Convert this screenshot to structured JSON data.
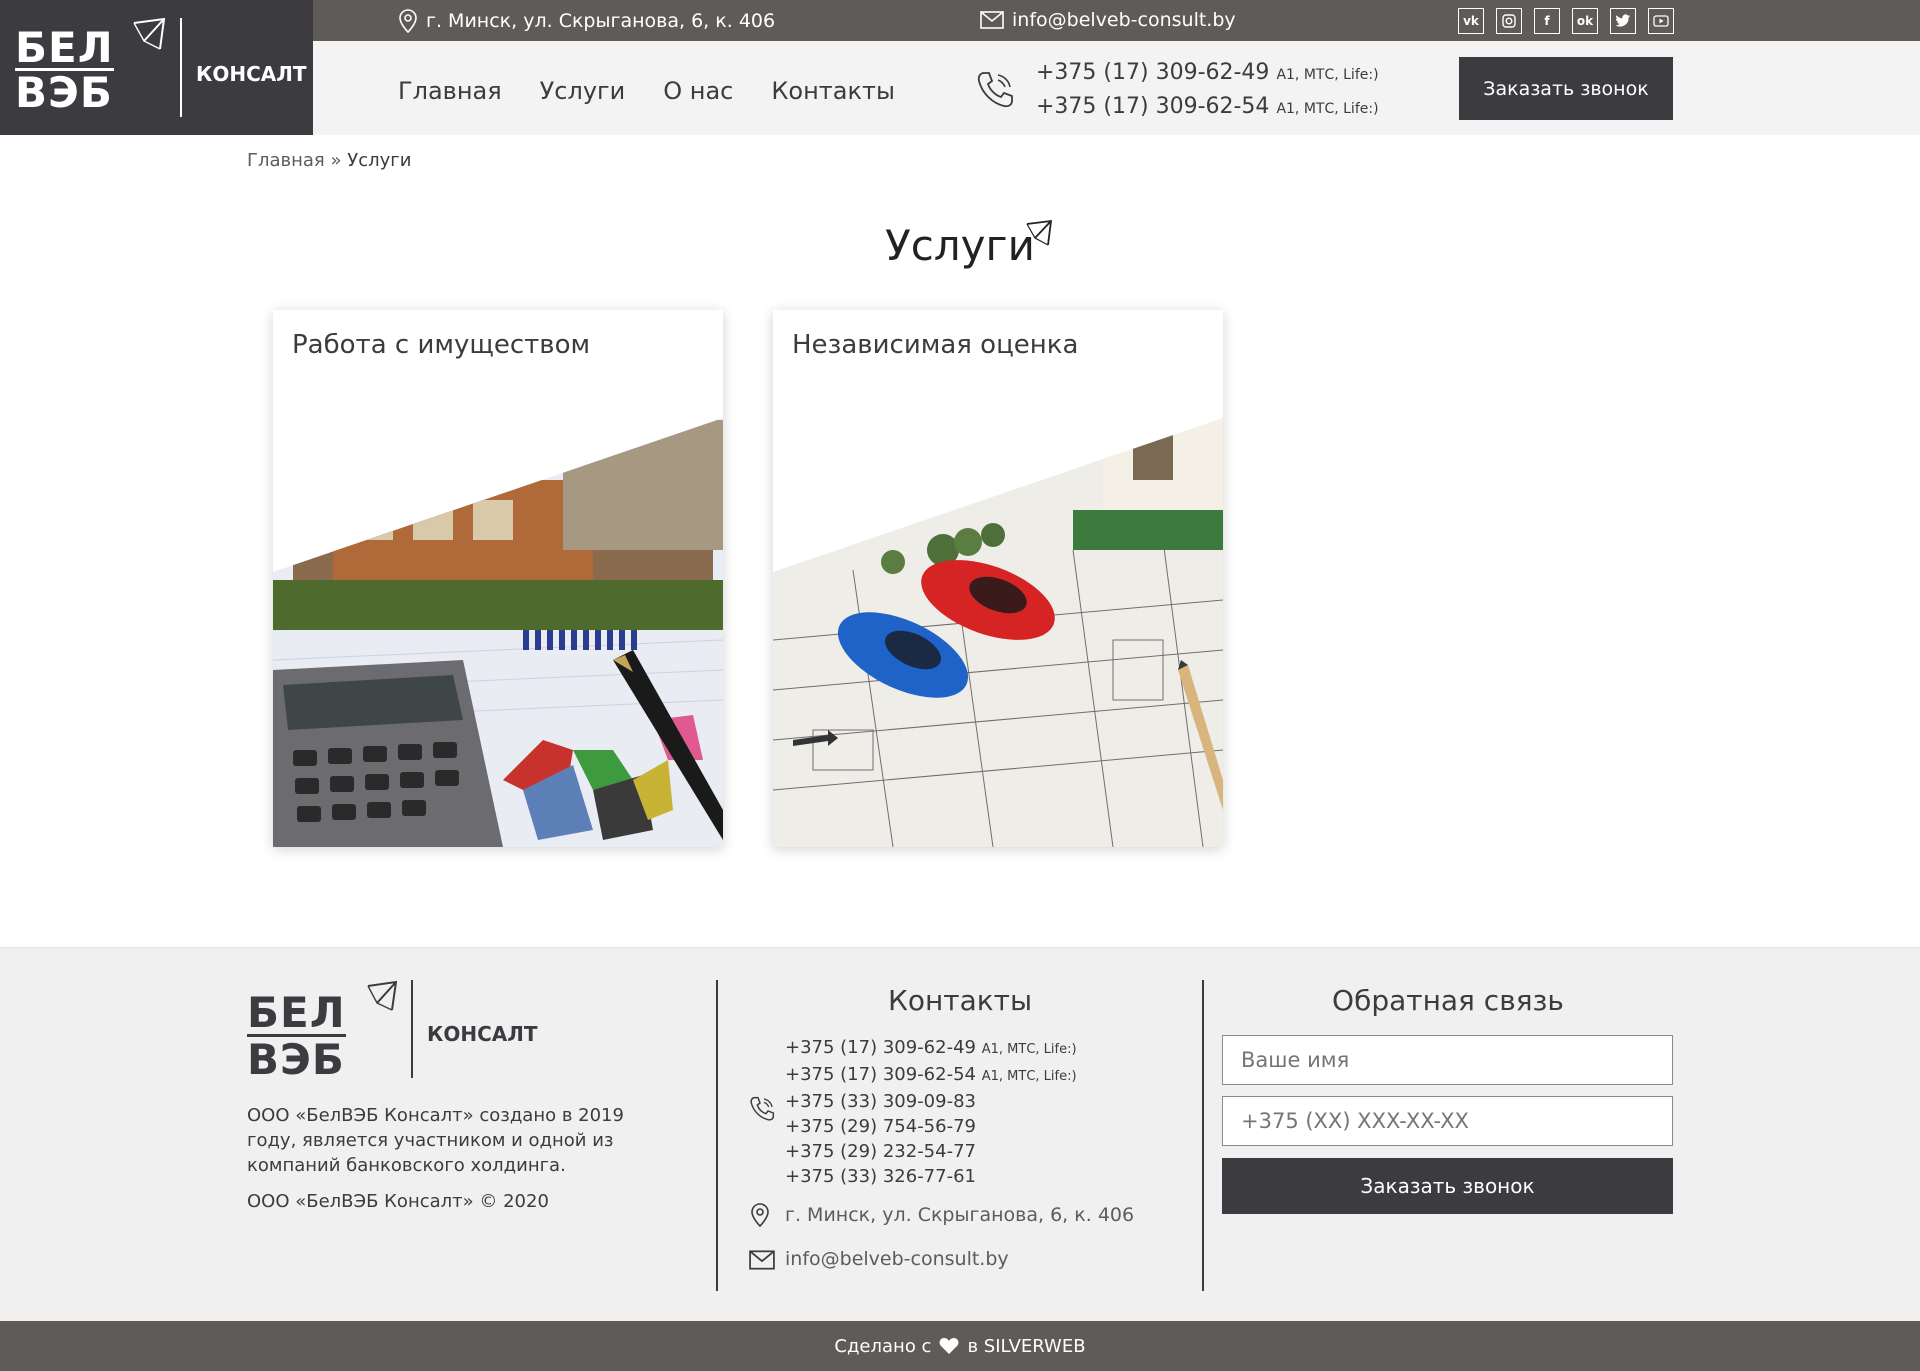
{
  "topbar": {
    "address": "г. Минск, ул. Скрыганова, 6, к. 406",
    "email": "info@belveb-consult.by",
    "socials": [
      "vk",
      "instagram",
      "facebook",
      "odnoklassniki",
      "twitter",
      "youtube"
    ]
  },
  "logo": {
    "line1": "БЕЛ",
    "line2": "ВЭБ",
    "text": "КОНСАЛТ"
  },
  "nav": {
    "items": [
      {
        "label": "Главная"
      },
      {
        "label": "Услуги"
      },
      {
        "label": "О нас"
      },
      {
        "label": "Контакты"
      }
    ]
  },
  "header": {
    "phones": [
      {
        "number": "+375 (17) 309-62-49",
        "ops": "A1, МТС, Life:)"
      },
      {
        "number": "+375 (17) 309-62-54",
        "ops": "A1, МТС, Life:)"
      }
    ],
    "call_button": "Заказать звонок"
  },
  "breadcrumb": {
    "home": "Главная",
    "sep": "»",
    "current": "Услуги"
  },
  "page": {
    "title": "Услуги"
  },
  "cards": [
    {
      "title": "Работа с имуществом"
    },
    {
      "title": "Независимая оценка"
    }
  ],
  "footer": {
    "description": "ООО «БелВЭБ Консалт» создано в 2019 году, является участником и одной из компаний банковского холдинга.",
    "copyright": "ООО «БелВЭБ Консалт» © 2020",
    "contacts_heading": "Контакты",
    "phones": [
      {
        "number": "+375 (17) 309-62-49",
        "ops": "A1, МТС, Life:)"
      },
      {
        "number": "+375 (17) 309-62-54",
        "ops": "A1, МТС, Life:)"
      },
      {
        "number": "+375 (33) 309-09-83",
        "ops": ""
      },
      {
        "number": "+375 (29) 754-56-79",
        "ops": ""
      },
      {
        "number": "+375 (29) 232-54-77",
        "ops": ""
      },
      {
        "number": "+375 (33) 326-77-61",
        "ops": ""
      }
    ],
    "address": "г. Минск, ул. Скрыганова, 6, к. 406",
    "email": "info@belveb-consult.by",
    "feedback_heading": "Обратная связь",
    "name_placeholder": "Ваше имя",
    "phone_placeholder": "+375 (XX) XXX-XX-XX",
    "submit": "Заказать звонок"
  },
  "bottom": {
    "made_with": "Сделано с",
    "in": "в SILVERWEB"
  },
  "colors": {
    "dark": "#3b3b40",
    "topbar": "#5f5b59",
    "header_bg": "#f3f3f3",
    "footer_bg": "#f0f0f0"
  }
}
